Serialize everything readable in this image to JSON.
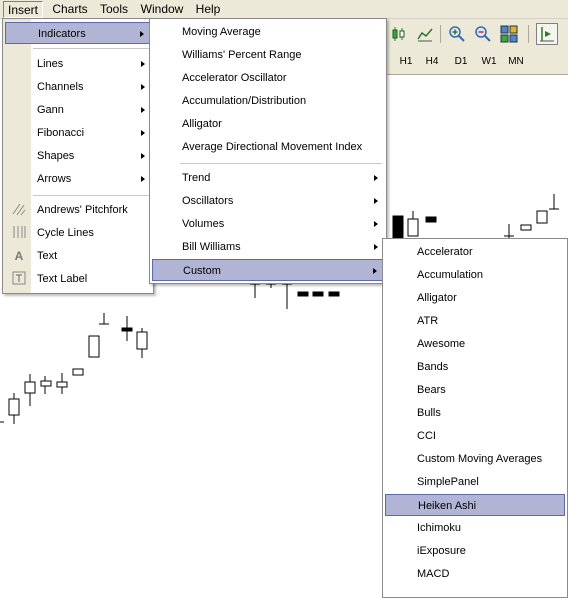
{
  "menubar": {
    "items": [
      "Insert",
      "Charts",
      "Tools",
      "Window",
      "Help"
    ]
  },
  "timeframes": [
    "H1",
    "H4",
    "D1",
    "W1",
    "MN"
  ],
  "insert_menu": {
    "items": [
      {
        "label": "Indicators",
        "submenu": true,
        "selected": true
      },
      {
        "label": "Lines",
        "submenu": true
      },
      {
        "label": "Channels",
        "submenu": true
      },
      {
        "label": "Gann",
        "submenu": true
      },
      {
        "label": "Fibonacci",
        "submenu": true
      },
      {
        "label": "Shapes",
        "submenu": true
      },
      {
        "label": "Arrows",
        "submenu": true
      },
      {
        "label": "Andrews' Pitchfork",
        "icon": "pitchfork-icon"
      },
      {
        "label": "Cycle Lines",
        "icon": "cycle-lines-icon"
      },
      {
        "label": "Text",
        "icon": "text-icon"
      },
      {
        "label": "Text Label",
        "icon": "text-label-icon"
      }
    ]
  },
  "indicators_menu": {
    "items": [
      {
        "label": "Moving Average"
      },
      {
        "label": "Williams' Percent Range"
      },
      {
        "label": "Accelerator Oscillator"
      },
      {
        "label": "Accumulation/Distribution"
      },
      {
        "label": "Alligator"
      },
      {
        "label": "Average Directional Movement Index"
      },
      {
        "label": "Trend",
        "submenu": true
      },
      {
        "label": "Oscillators",
        "submenu": true
      },
      {
        "label": "Volumes",
        "submenu": true
      },
      {
        "label": "Bill Williams",
        "submenu": true
      },
      {
        "label": "Custom",
        "submenu": true,
        "selected": true
      }
    ]
  },
  "custom_menu": {
    "items": [
      "Accelerator",
      "Accumulation",
      "Alligator",
      "ATR",
      "Awesome",
      "Bands",
      "Bears",
      "Bulls",
      "CCI",
      "Custom Moving Averages",
      "SimplePanel",
      "Heiken Ashi",
      "Ichimoku",
      "iExposure",
      "MACD"
    ],
    "selected": "Heiken Ashi"
  }
}
